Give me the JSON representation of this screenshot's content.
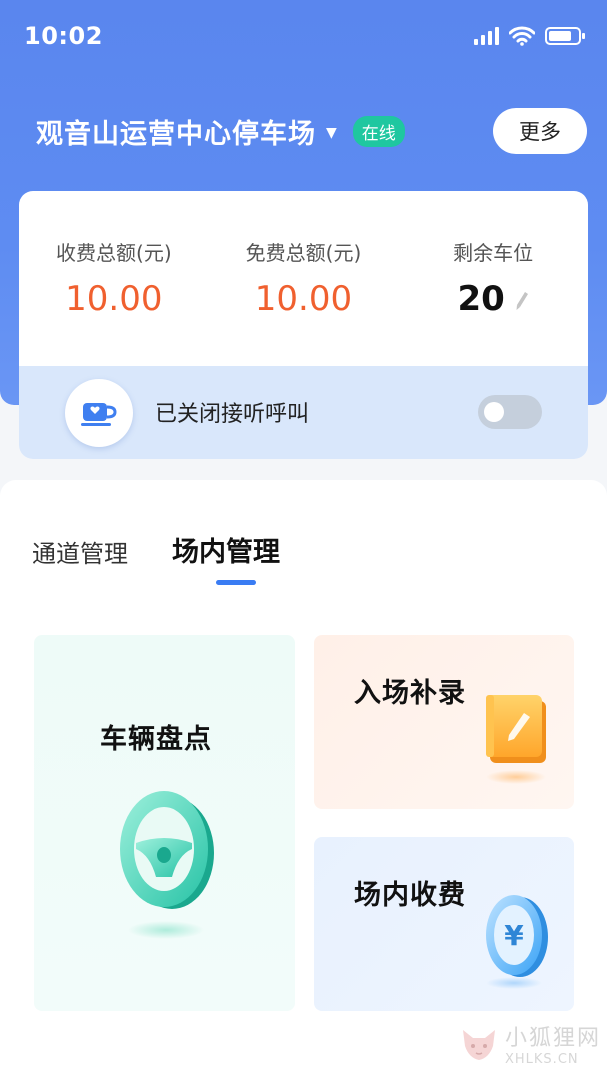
{
  "status_bar": {
    "time": "10:02"
  },
  "header": {
    "lot_name": "观音山运营中心停车场",
    "status_badge": "在线",
    "more_button": "更多"
  },
  "stats": [
    {
      "label": "收费总额(元)",
      "value": "10.00"
    },
    {
      "label": "免费总额(元)",
      "value": "10.00"
    },
    {
      "label": "剩余车位",
      "value": "20"
    }
  ],
  "call": {
    "label": "已关闭接听呼叫",
    "enabled": false
  },
  "tabs": [
    {
      "label": "通道管理",
      "active": false
    },
    {
      "label": "场内管理",
      "active": true
    }
  ],
  "cards": {
    "vehicle_check": {
      "title": "车辆盘点",
      "icon": "steering-wheel-icon"
    },
    "entry_supplement": {
      "title": "入场补录",
      "icon": "notebook-edit-icon"
    },
    "in_lot_fee": {
      "title": "场内收费",
      "icon": "yuan-coin-icon"
    }
  },
  "watermark": {
    "cn": "小狐狸网",
    "en": "XHLKS.CN"
  },
  "colors": {
    "brand_blue": "#5a86ee",
    "amount_orange": "#f0602f",
    "online_green": "#1fc7a0",
    "tab_indicator": "#3a7cf3"
  }
}
